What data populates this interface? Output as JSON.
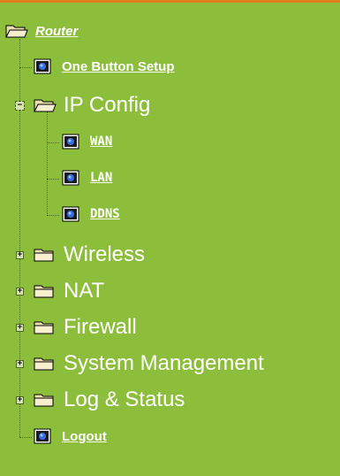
{
  "nav": {
    "root_label": "Router",
    "one_button_setup": "One Button Setup",
    "ip_config": {
      "label": "IP Config",
      "expander": "−",
      "children": [
        "WAN",
        "LAN",
        "DDNS"
      ]
    },
    "groups": [
      {
        "label": "Wireless",
        "expander": "+"
      },
      {
        "label": "NAT",
        "expander": "+"
      },
      {
        "label": "Firewall",
        "expander": "+"
      },
      {
        "label": "System Management",
        "expander": "+"
      },
      {
        "label": "Log & Status",
        "expander": "+"
      }
    ],
    "logout": "Logout"
  },
  "colors": {
    "background": "#8cbe3c",
    "top_accent": "#e07b1a",
    "text": "#ffffff"
  },
  "icons": {
    "folder": "folder-icon",
    "page": "page-icon"
  }
}
